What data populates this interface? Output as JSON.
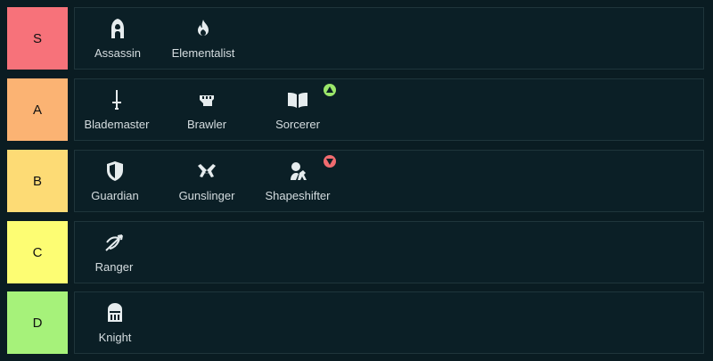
{
  "tiers": [
    {
      "label": "S",
      "color": "#f7727a",
      "items": [
        {
          "name": "Assassin",
          "icon": "hooded-figure-icon"
        },
        {
          "name": "Elementalist",
          "icon": "flame-icon"
        }
      ]
    },
    {
      "label": "A",
      "color": "#fbb373",
      "items": [
        {
          "name": "Blademaster",
          "icon": "sword-icon"
        },
        {
          "name": "Brawler",
          "icon": "fist-icon"
        },
        {
          "name": "Sorcerer",
          "icon": "open-book-icon",
          "trend": "up",
          "trend_color": "#9be66a"
        }
      ]
    },
    {
      "label": "B",
      "color": "#fddb75",
      "items": [
        {
          "name": "Guardian",
          "icon": "shield-icon"
        },
        {
          "name": "Gunslinger",
          "icon": "crossed-pistols-icon"
        },
        {
          "name": "Shapeshifter",
          "icon": "shapeshifter-icon",
          "trend": "down",
          "trend_color": "#f06b6f"
        }
      ]
    },
    {
      "label": "C",
      "color": "#fdfd73",
      "items": [
        {
          "name": "Ranger",
          "icon": "bow-arrow-icon"
        }
      ]
    },
    {
      "label": "D",
      "color": "#a6f27a",
      "items": [
        {
          "name": "Knight",
          "icon": "knight-helmet-icon"
        }
      ]
    }
  ]
}
